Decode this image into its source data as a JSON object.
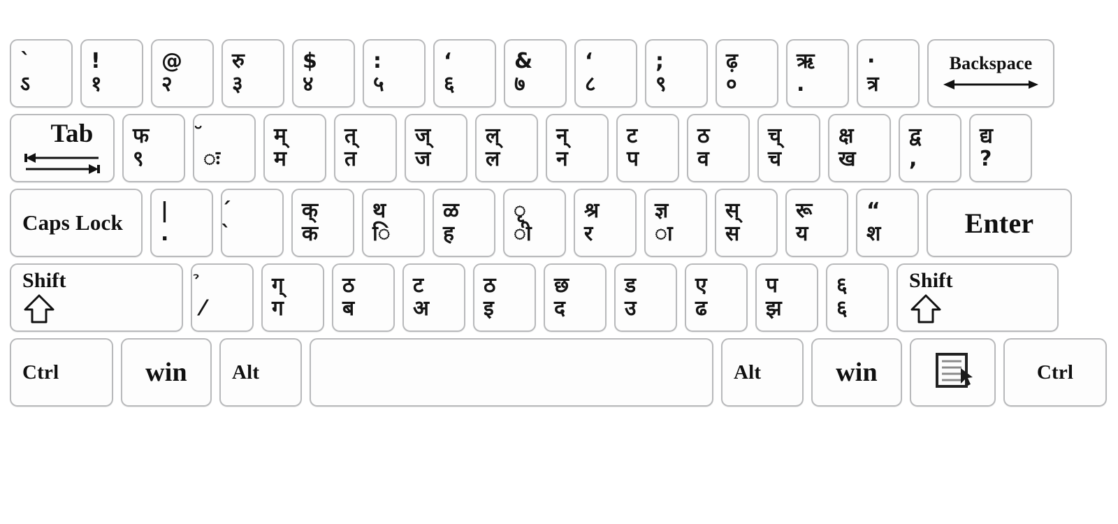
{
  "keyboard": {
    "name": "Devanagari (Hindi) Typewriter Keyboard Layout",
    "colors": {
      "key_face": "#fdfdfd",
      "key_border": "#b8b9bb",
      "legend": "#141414",
      "background": "#ffffff"
    },
    "rows": [
      {
        "id": "number-row",
        "keys": [
          {
            "name": "key-backquote",
            "top": "`",
            "bottom": "ऽ",
            "type": "char"
          },
          {
            "name": "key-1",
            "top": "!",
            "bottom": "१",
            "type": "char"
          },
          {
            "name": "key-2",
            "top": "@",
            "bottom": "२",
            "type": "char"
          },
          {
            "name": "key-3",
            "top": "रु",
            "bottom": "३",
            "type": "char"
          },
          {
            "name": "key-4",
            "top": "$",
            "bottom": "४",
            "type": "char"
          },
          {
            "name": "key-5",
            "top": ":",
            "bottom": "५",
            "type": "char"
          },
          {
            "name": "key-6",
            "top": "‘",
            "bottom": "६",
            "type": "char"
          },
          {
            "name": "key-7",
            "top": "&",
            "bottom": "७",
            "type": "char"
          },
          {
            "name": "key-8",
            "top": "‘",
            "bottom": "८",
            "type": "char"
          },
          {
            "name": "key-9",
            "top": ";",
            "bottom": "९",
            "type": "char"
          },
          {
            "name": "key-0",
            "top": "ढ़",
            "bottom": "०",
            "type": "char"
          },
          {
            "name": "key-minus",
            "top": "ऋ",
            "bottom": ".",
            "type": "char"
          },
          {
            "name": "key-equal",
            "top": "·",
            "bottom": "त्र",
            "type": "char"
          },
          {
            "name": "key-backspace",
            "label": "Backspace",
            "type": "backspace"
          }
        ]
      },
      {
        "id": "tab-row",
        "keys": [
          {
            "name": "key-tab",
            "label": "Tab",
            "type": "tab"
          },
          {
            "name": "key-q",
            "top": "फ",
            "bottom": "९",
            "type": "char"
          },
          {
            "name": "key-w",
            "top": "̆",
            "bottom": "ः",
            "type": "char"
          },
          {
            "name": "key-e",
            "top": "म्",
            "bottom": "म",
            "type": "char"
          },
          {
            "name": "key-r",
            "top": "त्",
            "bottom": "त",
            "type": "char"
          },
          {
            "name": "key-t",
            "top": "ज्",
            "bottom": "ज",
            "type": "char"
          },
          {
            "name": "key-y",
            "top": "ल्",
            "bottom": "ल",
            "type": "char"
          },
          {
            "name": "key-u",
            "top": "न्",
            "bottom": "न",
            "type": "char"
          },
          {
            "name": "key-i",
            "top": "ट",
            "bottom": "प",
            "type": "char"
          },
          {
            "name": "key-o",
            "top": "ठ",
            "bottom": "व",
            "type": "char"
          },
          {
            "name": "key-p",
            "top": "च्",
            "bottom": "च",
            "type": "char"
          },
          {
            "name": "key-bracketleft",
            "top": "क्ष",
            "bottom": "ख",
            "type": "char"
          },
          {
            "name": "key-bracketright",
            "top": "द्व",
            "bottom": ",",
            "type": "char"
          },
          {
            "name": "key-backslash",
            "top": "द्य",
            "bottom": "?",
            "type": "char"
          }
        ]
      },
      {
        "id": "home-row",
        "keys": [
          {
            "name": "key-capslock",
            "label": "Caps Lock",
            "type": "capslock"
          },
          {
            "name": "key-a",
            "top": "|",
            "bottom": ".",
            "type": "char"
          },
          {
            "name": "key-s",
            "top": "́",
            "bottom": "̀",
            "type": "char"
          },
          {
            "name": "key-d",
            "top": "क्",
            "bottom": "क",
            "type": "char"
          },
          {
            "name": "key-f",
            "top": "थ",
            "bottom": "ि",
            "type": "char"
          },
          {
            "name": "key-g",
            "top": "ळ",
            "bottom": "ह",
            "type": "char"
          },
          {
            "name": "key-h",
            "top": "ृ",
            "bottom": "ी",
            "type": "char"
          },
          {
            "name": "key-j",
            "top": "श्र",
            "bottom": "र",
            "type": "char"
          },
          {
            "name": "key-k",
            "top": "ज्ञ",
            "bottom": "ा",
            "type": "char"
          },
          {
            "name": "key-l",
            "top": "स्",
            "bottom": "स",
            "type": "char"
          },
          {
            "name": "key-semicolon",
            "top": "रू",
            "bottom": "य",
            "type": "char"
          },
          {
            "name": "key-quote",
            "top": "“",
            "bottom": "श",
            "type": "char"
          },
          {
            "name": "key-enter",
            "label": "Enter",
            "type": "enter"
          }
        ]
      },
      {
        "id": "shift-row",
        "keys": [
          {
            "name": "key-shift-left",
            "label": "Shift",
            "type": "shift"
          },
          {
            "name": "key-z",
            "top": "̉",
            "bottom": "⁄",
            "type": "char"
          },
          {
            "name": "key-x",
            "top": "ग्",
            "bottom": "ग",
            "type": "char"
          },
          {
            "name": "key-c",
            "top": "ठ",
            "bottom": "ब",
            "type": "char"
          },
          {
            "name": "key-v",
            "top": "ट",
            "bottom": "अ",
            "type": "char"
          },
          {
            "name": "key-b",
            "top": "ठ",
            "bottom": "इ",
            "type": "char"
          },
          {
            "name": "key-n",
            "top": "छ",
            "bottom": "द",
            "type": "char"
          },
          {
            "name": "key-m",
            "top": "ड",
            "bottom": "उ",
            "type": "char"
          },
          {
            "name": "key-comma",
            "top": "ए",
            "bottom": "ढ",
            "type": "char"
          },
          {
            "name": "key-period",
            "top": "प",
            "bottom": "झ",
            "type": "char"
          },
          {
            "name": "key-slash",
            "top": "६",
            "bottom": "६",
            "type": "char"
          },
          {
            "name": "key-shift-right",
            "label": "Shift",
            "type": "shift"
          }
        ]
      },
      {
        "id": "bottom-row",
        "keys": [
          {
            "name": "key-ctrl-left",
            "label": "Ctrl",
            "type": "ctrl"
          },
          {
            "name": "key-win-left",
            "label": "win",
            "type": "win"
          },
          {
            "name": "key-alt-left",
            "label": "Alt",
            "type": "alt"
          },
          {
            "name": "key-space",
            "label": "",
            "type": "space"
          },
          {
            "name": "key-alt-right",
            "label": "Alt",
            "type": "alt"
          },
          {
            "name": "key-win-right",
            "label": "win",
            "type": "win"
          },
          {
            "name": "key-menu",
            "label": "",
            "type": "menu"
          },
          {
            "name": "key-ctrl-right",
            "label": "Ctrl",
            "type": "ctrl"
          }
        ]
      }
    ],
    "icons": {
      "backspace": "left-arrow-icon",
      "tab": "tab-arrows-icon",
      "shift": "up-arrow-outline-icon",
      "menu": "context-menu-icon"
    }
  }
}
